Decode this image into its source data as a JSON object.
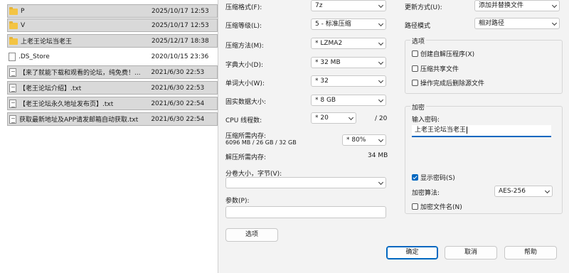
{
  "files": [
    {
      "name": "P",
      "date": "2025/10/17 12:53",
      "icon": "folder-icon",
      "selected": true
    },
    {
      "name": "V",
      "date": "2025/10/17 12:53",
      "icon": "folder-icon",
      "selected": true
    },
    {
      "name": "上老王论坛当老王",
      "date": "2025/12/17 18:38",
      "icon": "folder-icon",
      "selected": true
    },
    {
      "name": ".DS_Store",
      "date": "2020/10/15 23:36",
      "icon": "file-icon",
      "selected": false
    },
    {
      "name": "【来了就能下载和观看的论坛，纯免费！...",
      "date": "2021/6/30 22:53",
      "icon": "text-file-icon",
      "selected": true
    },
    {
      "name": "【老王论坛介绍】.txt",
      "date": "2021/6/30 22:53",
      "icon": "text-file-icon",
      "selected": true
    },
    {
      "name": "【老王论坛永久地址发布页】.txt",
      "date": "2021/6/30 22:54",
      "icon": "text-file-icon",
      "selected": true
    },
    {
      "name": "获取最新地址及APP请发邮箱自动获取.txt",
      "date": "2021/6/30 22:54",
      "icon": "text-file-icon",
      "selected": true
    }
  ],
  "dialog": {
    "format_label": "压缩格式(F):",
    "format_value": "7z",
    "level_label": "压缩等级(L):",
    "level_value": "5 - 标准压缩",
    "method_label": "压缩方法(M):",
    "method_value": "* LZMA2",
    "dict_label": "字典大小(D):",
    "dict_value": "* 32 MB",
    "word_label": "单词大小(W):",
    "word_value": "* 32",
    "solid_label": "固实数据大小:",
    "solid_value": "* 8 GB",
    "cpu_label": "CPU 线程数:",
    "cpu_value": "* 20",
    "cpu_max": "/ 20",
    "mem_comp_label": "压缩所需内存:",
    "mem_comp_detail": "6096 MB / 26 GB / 32 GB",
    "mem_percent": "* 80%",
    "mem_decomp_label": "解压所需内存:",
    "mem_decomp_value": "34 MB",
    "split_label": "分卷大小，字节(V):",
    "split_value": "",
    "params_label": "参数(P):",
    "params_value": "",
    "options_button": "选项",
    "update_label": "更新方式(U):",
    "update_value": "添加并替换文件",
    "path_label": "路径模式",
    "path_value": "相对路径",
    "options_group_title": "选项",
    "opt_sfx": "创建自解压程序(X)",
    "opt_sfx_checked": false,
    "opt_shared": "压缩共享文件",
    "opt_shared_checked": false,
    "opt_delete": "操作完成后删除源文件",
    "opt_delete_checked": false,
    "encrypt_group_title": "加密",
    "password_label": "输入密码:",
    "password_value": "上老王论坛当老王",
    "show_password": "显示密码(S)",
    "show_password_checked": true,
    "enc_method_label": "加密算法:",
    "enc_method_value": "AES-256",
    "encrypt_names": "加密文件名(N)",
    "encrypt_names_checked": false,
    "ok": "确定",
    "cancel": "取消",
    "help": "帮助"
  }
}
